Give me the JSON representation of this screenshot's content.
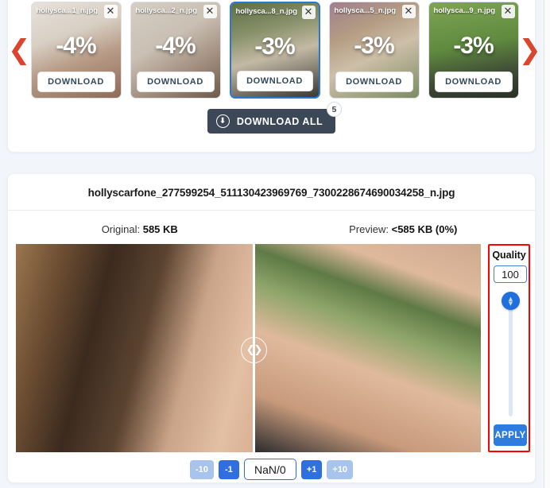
{
  "colors": {
    "accent_blue": "#2f7ce0",
    "accent_blue_light": "#a8c4ec",
    "arrow_red": "#d9452f",
    "dark_slate": "#3c4858",
    "highlight_red": "#ff0000",
    "page_bg": "#f2f6fb"
  },
  "gallery": {
    "prev_arrow_icon": "chevron-left-icon",
    "next_arrow_icon": "chevron-right-icon",
    "download_label": "DOWNLOAD",
    "close_icon": "close-icon",
    "items": [
      {
        "name": "hollysca...1_n.jpg",
        "percent": "-4%",
        "selected": false
      },
      {
        "name": "hollysca...2_n.jpg",
        "percent": "-4%",
        "selected": false
      },
      {
        "name": "hollysca...8_n.jpg",
        "percent": "-3%",
        "selected": true
      },
      {
        "name": "hollysca...5_n.jpg",
        "percent": "-3%",
        "selected": false
      },
      {
        "name": "hollysca...9_n.jpg",
        "percent": "-3%",
        "selected": false
      }
    ],
    "download_all": {
      "label": "DOWNLOAD ALL",
      "badge": "5",
      "icon": "download-circle-icon"
    }
  },
  "detail": {
    "filename": "hollyscarfone_277599254_511130423969769_7300228674690034258_n.jpg",
    "original_prefix": "Original: ",
    "original_value": "585 KB",
    "preview_prefix": "Preview: ",
    "preview_value": "<585 KB (0%)",
    "compare_handle_icon": "left-right-arrows-icon"
  },
  "quality": {
    "label": "Quality",
    "value": "100",
    "slider_icon": "up-down-chevrons-icon",
    "apply_label": "APPLY"
  },
  "stepper": {
    "minus_ten": "-10",
    "minus_one": "-1",
    "value": "NaN/0",
    "plus_one": "+1",
    "plus_ten": "+10"
  }
}
